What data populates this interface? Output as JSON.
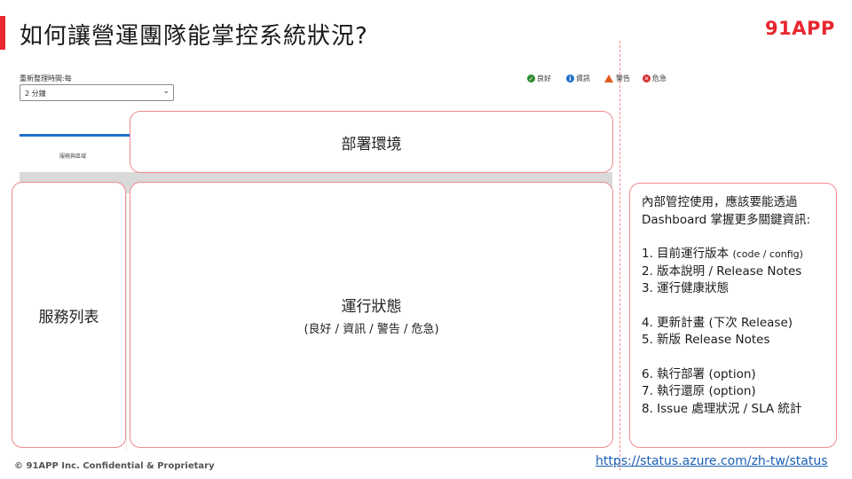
{
  "slide": {
    "title": "如何讓營運團隊能掌控系統狀況?",
    "brand": "91APP"
  },
  "embedded": {
    "refresh_label": "重新整理時間:每",
    "refresh_value": "2 分鐘",
    "legend": [
      {
        "label": "良好",
        "icon": "check-circle-icon",
        "color": "#2e8b2e"
      },
      {
        "label": "資訊",
        "icon": "info-circle-icon",
        "color": "#1f6fc7"
      },
      {
        "label": "警告",
        "icon": "warning-triangle-icon",
        "color": "#e05a1c"
      },
      {
        "label": "危急",
        "icon": "error-circle-icon",
        "color": "#d63030"
      }
    ],
    "tab_label": "服務與區域"
  },
  "callouts": {
    "deploy_env": "部署環境",
    "service_list": "服務列表",
    "run_status": "運行狀態",
    "run_status_detail": "(良好 / 資訊 / 警告 / 危急)"
  },
  "notes": {
    "intro": "內部管控使用，應該要能透過 Dashboard 掌握更多關鍵資訊:",
    "items_a": [
      {
        "main": "1. 目前運行版本 ",
        "small": "(code / config)"
      },
      {
        "main": "2. 版本說明 / Release Notes",
        "small": ""
      },
      {
        "main": "3. 運行健康狀態",
        "small": ""
      }
    ],
    "items_b": [
      "4. 更新計畫 (下次 Release)",
      "5. 新版 Release Notes"
    ],
    "items_c": [
      "6. 執行部署 (option)",
      "7. 執行還原 (option)",
      "8. Issue 處理狀況 / SLA 統計"
    ]
  },
  "footer": {
    "copyright": "© 91APP Inc. Confidential & Proprietary",
    "link": "https://status.azure.com/zh-tw/status"
  },
  "colors": {
    "accent": "#e8262e",
    "callout_border": "#f08a90",
    "link": "#1a5fb4",
    "tab_blue": "#1f6fc7"
  }
}
